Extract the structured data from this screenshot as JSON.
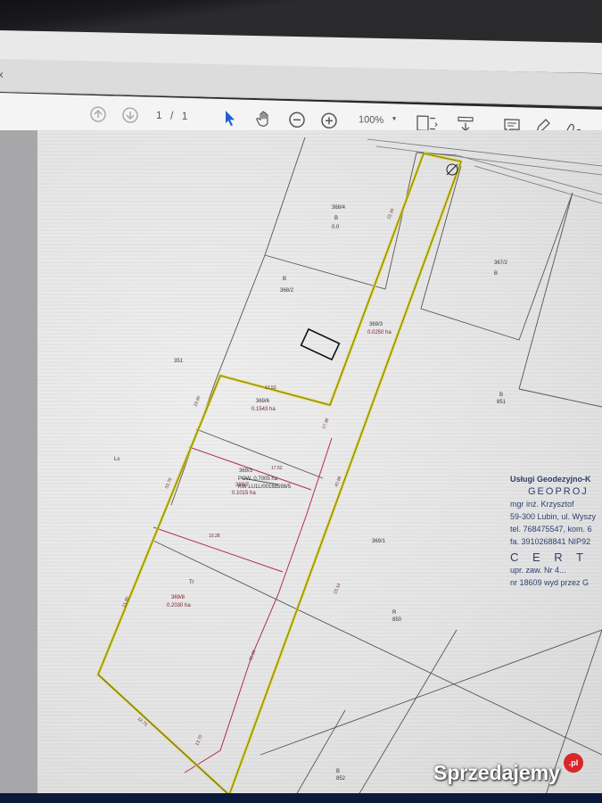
{
  "viewer": {
    "tab_close": "x",
    "page_current": "1",
    "page_sep": "/",
    "page_total": "1",
    "zoom": "100%",
    "zoom_caret": "▾",
    "icons": [
      "page-up-icon",
      "page-down-icon",
      "select-arrow-icon",
      "hand-tool-icon",
      "zoom-out-icon",
      "zoom-in-icon",
      "fit-page-icon",
      "download-icon",
      "comment-icon",
      "pen-icon",
      "sign-icon"
    ]
  },
  "map": {
    "parcels": {
      "p368_4": {
        "id": "368/4",
        "class": "B",
        "area": "0.0"
      },
      "p368_2": {
        "id": "368/2",
        "class": "B"
      },
      "p369_3": {
        "id": "369/3",
        "area": "0.0250 ha"
      },
      "p367_2": {
        "id": "367/2",
        "class": "B"
      },
      "p369_6": {
        "id": "369/6",
        "area": "0.1543 ha"
      },
      "p369_7": {
        "id": "369/7",
        "area": "0.1015 ha"
      },
      "p369_8": {
        "id": "369/8",
        "area": "0.2030 ha"
      },
      "p369_1": {
        "id": "369/1"
      },
      "p351": {
        "id": "351"
      },
      "center_id": "369/3",
      "center_pow": "POW. 0.7005 ha",
      "center_kw": "KW LU1L/00168598/5"
    },
    "dims": [
      "22.34",
      "17.53",
      "17.52",
      "10.28",
      "19.90",
      "33.78",
      "21.80",
      "40.96",
      "36.00",
      "17.38",
      "12.75",
      "13.70",
      "23.14"
    ],
    "labels": {
      "r": "R",
      "b": "B",
      "ls": "Ls",
      "tr": "Tr",
      "w": "B",
      "num1": "851",
      "num2": "850",
      "num3": "852"
    }
  },
  "stamp": {
    "line1": "Usługi Geodezyjno-K",
    "line2": "GEOPROJ",
    "line3": "mgr inż. Krzysztof",
    "line4": "59-300 Lubin, ul. Wyszy",
    "line5": "tel. 768475547, kom. 6",
    "line6": "fa. 3910268841  NIP92",
    "line7": "C E R T",
    "line8": "upr. zaw. Nr 4...",
    "line9": "nr 18609 wyd przez G"
  },
  "watermark": {
    "text": "Sprzedajemy",
    "suffix": ".pl"
  }
}
